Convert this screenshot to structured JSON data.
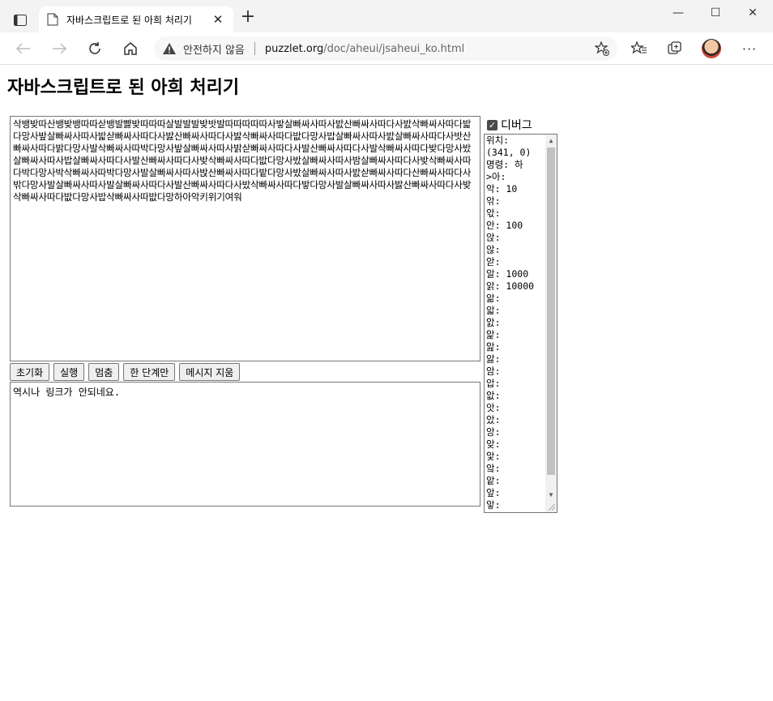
{
  "browser": {
    "tab_title": "자바스크립트로 된 아희 처리기",
    "security_text": "안전하지 않음",
    "url_host": "puzzlet.org",
    "url_path": "/doc/aheui/jsaheui_ko.html"
  },
  "page": {
    "title": "자바스크립트로 된 아희 처리기",
    "code": "삭뱅밪따산뱅밪뱅따따삳뱅발뺧밪따따따살발발발밪밧발따따따따따사밯살빠싸사따사밠산빠싸사따다사밠삭빠싸사따다밟다망사밮살빠싸사따사밟삳빠싸사따다사밣산빠싸사따다사밣삭빠싸사따다밦다망사밥살빠싸사따사밠살빠싸사따다사밧산빠싸사따다밝다망사발삭빠싸사따박다망사밮살빠싸사따사밝삳빠싸사따다사발산빠싸사따다사발삭빠싸사따다밪다망사밨살빠싸사따사밥살빠싸사따다사발산빠싸사따다사밪삭빠싸사따다밦다망사밨살빠싸사따사밤살빠싸사따다사밪삭빠싸사따다박다망사박삭빠싸사따박다망사발살빠싸사따사밙산빠싸사따다밭다망사밨살빠싸사따사밠삳빠싸사따다산빠싸사따다사밖다망사발살빠싸사따사발살빠싸사따다사발산빠싸사따다사밨삭빠싸사따다밯다망사발살빠싸사따사밣산빠싸사따다사밪삭빠싸사따다밦다망사밥삭빠싸사따밦다망하아악키위기여워",
    "buttons": {
      "reset": "초기화",
      "run": "실행",
      "stop": "멈춤",
      "step": "한 단계만",
      "clear": "메시지 지움"
    },
    "message": "역시나 링크가 안되네요.",
    "debug_label": "디버그",
    "debug_lines": [
      "위치:",
      "(341, 0)",
      "명령: 하",
      ">아:",
      "악: 10",
      "앆:",
      "앇:",
      "안: 100",
      "앉:",
      "않:",
      "앋:",
      "알: 1000",
      "앍: 10000",
      "앎:",
      "앏:",
      "앐:",
      "앑:",
      "앒:",
      "앓:",
      "암:",
      "압:",
      "앖:",
      "앗:",
      "았:",
      "앙:",
      "앚:",
      "앛:",
      "앜:",
      "앝:",
      "앞:",
      "앟:"
    ]
  }
}
